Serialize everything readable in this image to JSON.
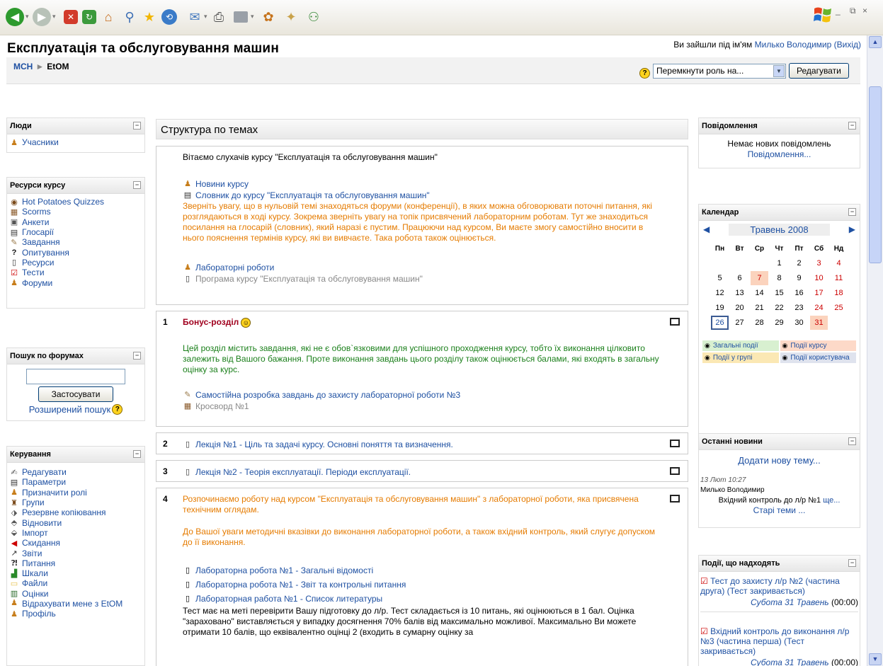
{
  "page": {
    "title": "Експлуатація та обслуговування машин"
  },
  "login": {
    "prefix": "Ви зайшли під ім'ям",
    "user": "Милько Володимир",
    "logout": "(Вихід)"
  },
  "breadcrumb": {
    "home": "МСН",
    "sep": "►",
    "current": "EtOM"
  },
  "role": {
    "placeholder": "Перемкнути роль на...",
    "edit": "Редагувати"
  },
  "toolbar": {
    "icons": [
      "back-icon",
      "forward-icon",
      "stop-icon",
      "refresh-icon",
      "home-icon",
      "search-icon",
      "favorites-icon",
      "history-icon",
      "mail-icon",
      "print-icon",
      "edit-icon",
      "messenger-icon",
      "discuss-icon",
      "users-icon"
    ]
  },
  "people": {
    "title": "Люди",
    "participants": "Учасники"
  },
  "resources": {
    "title": "Ресурси курсу",
    "items": [
      "Hot Potatoes Quizzes",
      "Scorms",
      "Анкети",
      "Глосарії",
      "Завдання",
      "Опитування",
      "Ресурси",
      "Тести",
      "Форуми"
    ]
  },
  "forumsearch": {
    "title": "Пошук по форумах",
    "button": "Застосувати",
    "advanced": "Розширений пошук"
  },
  "admin": {
    "title": "Керування",
    "items": [
      "Редагувати",
      "Параметри",
      "Призначити ролі",
      "Групи",
      "Резервне копіювання",
      "Відновити",
      "Імпорт",
      "Скидання",
      "Звіти",
      "Питання",
      "Шкали",
      "Файли",
      "Оцінки",
      "Відрахувати мене з EtOM",
      "Профіль"
    ]
  },
  "topics": {
    "title": "Структура по темах"
  },
  "sec0": {
    "welcome": "Вітаємо слухачів курсу \"Експлуатація та обслуговування машин\"",
    "news": "Новини курсу",
    "glossary": "Словник до курсу \"Експлуатація та обслуговування машин\"",
    "note": "Зверніть увагу, що в нульовій темі знаходяться форуми (конференції), в яких можна обговорювати поточні питання, які розглядаються в ході курсу. Зокрема зверніть увагу на топік присвячений лабораторним роботам. Тут же знаходиться посилання на глосарій (словник), який наразі є пустим. Працюючи над курсом, Ви маєте змогу самостійно вносити в нього пояснення термінів курсу, які ви вивчаєте. Така робота також оцінюється.",
    "labs": "Лабораторні роботи",
    "program": "Програма курсу \"Експлуатація та обслуговування машин\""
  },
  "sec1": {
    "num": "1",
    "title": "Бонус-розділ",
    "text": "Цей розділ містить завдання, які не є обов`язковими для успішного проходження курсу, тобто їх виконання цілковито залежить від Вашого бажання. Проте виконання завдань цього розділу також оцінюється балами, які входять в загальну оцінку за курс.",
    "task": "Самостійна розробка завдань до захисту лабораторної роботи №3",
    "crossword": "Кросворд №1"
  },
  "sec2": {
    "num": "2",
    "lecture": "Лекція №1 - Ціль та задачі курсу. Основні поняття та визначення."
  },
  "sec3": {
    "num": "3",
    "lecture": "Лекція №2 - Теорія експлуатації. Періоди експлуатації."
  },
  "sec4": {
    "num": "4",
    "intro": "Розпочинаємо роботу над курсом \"Експлуатація та обслуговування машин\" з лабораторної роботи, яка присвячена технічним оглядам.",
    "note": "До Вашої уваги методичні вказівки до виконання лабораторної роботи, а також вхідний контроль, який слугує допуском до її виконання.",
    "l1": "Лабораторна робота №1 - Загальні відомості",
    "l2": "Лабораторна робота №1 - Звіт та контрольні питання",
    "l3": "Лабораторная работа №1 - Список литературы",
    "test": "Тест має на меті перевірити Вашу підготовку до л/р. Тест складається із 10 питань, які оцінюються в 1 бал. Оцінка \"зараховано\" виставляється у випадку досягнення 70% балів від максимально можливої. Максимально Ви можете отримати 10 балів, що еквівалентно оцінці 2 (входить в сумарну оцінку за"
  },
  "messages": {
    "title": "Повідомлення",
    "none": "Немає нових повідомлень",
    "link": "Повідомлення..."
  },
  "calendar": {
    "title": "Календар",
    "month": "Травень 2008",
    "days": [
      "Пн",
      "Вт",
      "Ср",
      "Чт",
      "Пт",
      "Сб",
      "Нд"
    ],
    "weeks": [
      [
        "",
        "",
        "",
        "1",
        "2",
        "3",
        "4"
      ],
      [
        "5",
        "6",
        "7",
        "8",
        "9",
        "10",
        "11"
      ],
      [
        "12",
        "13",
        "14",
        "15",
        "16",
        "17",
        "18"
      ],
      [
        "19",
        "20",
        "21",
        "22",
        "23",
        "24",
        "25"
      ],
      [
        "26",
        "27",
        "28",
        "29",
        "30",
        "31",
        ""
      ]
    ],
    "legend": [
      "Загальні події",
      "Події курсу",
      "Події у групі",
      "Події користувача"
    ]
  },
  "news": {
    "title": "Останні новини",
    "add": "Додати нову тему...",
    "date": "13 Лют 10:27",
    "author": "Милько Володимир",
    "item": "Вхідний контроль до л/р №1",
    "more": "ще...",
    "old": "Старі теми ..."
  },
  "upcoming": {
    "title": "Події, що надходять",
    "e1": "Тест до захисту л/р №2 (частина друга) (Тест закривається)",
    "e1date": "Субота 31 Травень",
    "e1time": "(00:00)",
    "e2": "Вхідний контроль до виконання л/р №3 (частина перша) (Тест закривається)",
    "e2date": "Субота 31 Травень",
    "e2time": "(00:00)"
  },
  "colors": {
    "link": "#1e50a2",
    "orange": "#e57b00",
    "green": "#1a7f1a",
    "bonus": "#a0001e",
    "weekend": "#cc0000"
  }
}
